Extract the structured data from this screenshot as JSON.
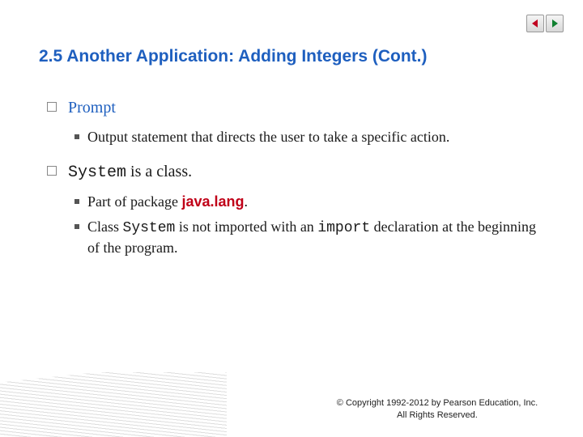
{
  "title": "2.5  Another Application: Adding Integers (Cont.)",
  "outline": {
    "item1_label": "Prompt",
    "item1_sub1": "Output statement that directs the user to take a specific action.",
    "item2_code": "System",
    "item2_rest": " is a class.",
    "item2_sub1_pre": "Part of package ",
    "item2_sub1_pkg": "java.lang",
    "item2_sub1_post": ".",
    "item2_sub2_pre": "Class ",
    "item2_sub2_code1": "System",
    "item2_sub2_mid": " is not imported with an ",
    "item2_sub2_code2": "import",
    "item2_sub2_post": " declaration at the beginning of the program."
  },
  "copyright": "© Copyright 1992-2012 by Pearson Education, Inc. All Rights Reserved."
}
